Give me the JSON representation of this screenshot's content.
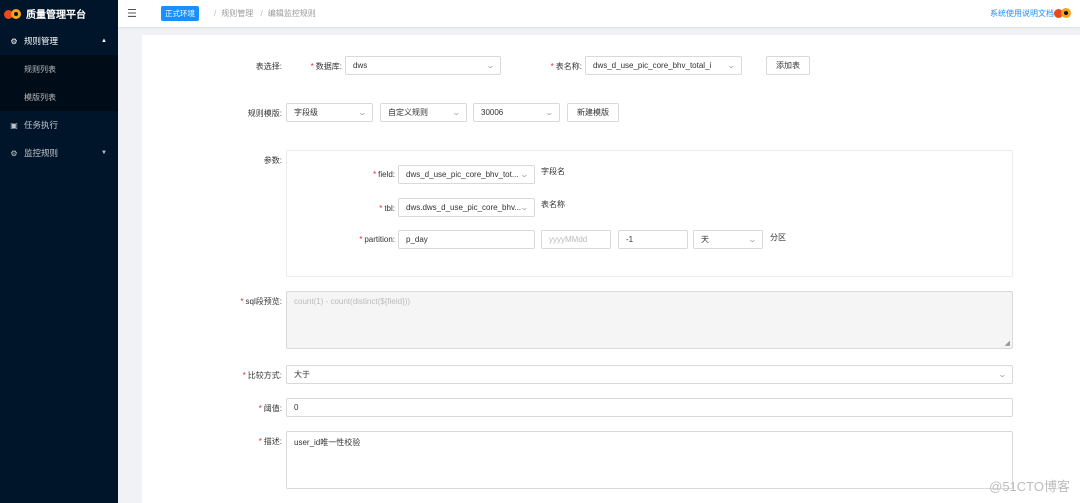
{
  "app": {
    "title": "质量管理平台"
  },
  "sidebar": {
    "items": [
      {
        "label": "规则管理",
        "icon": "gear-icon",
        "open": true,
        "children": [
          {
            "label": "规则列表"
          },
          {
            "label": "模版列表"
          }
        ]
      },
      {
        "label": "任务执行",
        "icon": "task-icon"
      },
      {
        "label": "监控规则",
        "icon": "gear-icon"
      }
    ]
  },
  "header": {
    "env_tag": "正式环境",
    "breadcrumb": [
      "规则管理",
      "编辑监控规则"
    ],
    "doc_link": "系统使用说明文档"
  },
  "form": {
    "table_select": {
      "label": "表选择:",
      "db_label": "数据库:",
      "db_value": "dws",
      "table_label": "表名称:",
      "table_value": "dws_d_use_pic_core_bhv_total_i",
      "add_button": "添加表"
    },
    "template": {
      "label": "规则模版:",
      "level": "字段级",
      "type": "自定义规则",
      "id": "30006",
      "new_button": "新建模版"
    },
    "params": {
      "label": "参数:",
      "field": {
        "label": "field:",
        "value": "dws_d_use_pic_core_bhv_tot...",
        "hint": "字段名"
      },
      "tbl": {
        "label": "tbl:",
        "value": "dws.dws_d_use_pic_core_bhv...",
        "hint": "表名称"
      },
      "partition": {
        "label": "partition:",
        "value": "p_day",
        "format_placeholder": "yyyyMMdd",
        "offset": "-1",
        "unit": "天",
        "hint": "分区"
      }
    },
    "sql_preview": {
      "label": "sql段预览:",
      "value": "count(1) - count(distinct(${field}))"
    },
    "compare": {
      "label": "比较方式:",
      "value": "大于"
    },
    "threshold": {
      "label": "阈值:",
      "value": "0"
    },
    "description": {
      "label": "描述:",
      "value": "user_id唯一性校验"
    }
  },
  "watermark": "@51CTO博客",
  "colors": {
    "sidebar_bg": "#001529",
    "accent": "#1890ff",
    "required": "#f5222d"
  }
}
